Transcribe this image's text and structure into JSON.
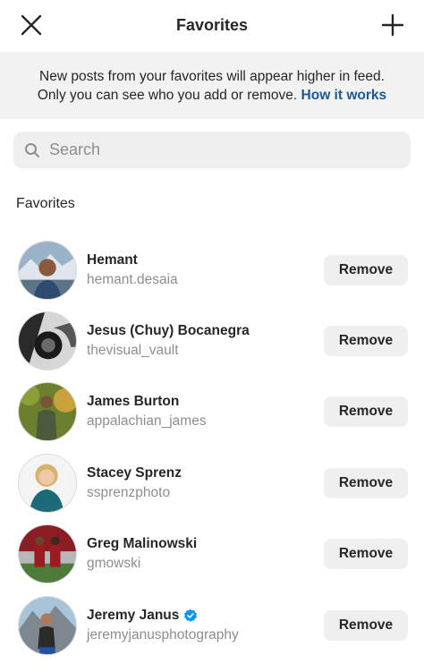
{
  "header": {
    "title": "Favorites",
    "close_icon": "close-icon",
    "add_icon": "plus-icon"
  },
  "banner": {
    "line1": "New posts from your favorites will appear higher in feed.",
    "line2": "Only you can see who you add or remove.",
    "link": "How it works",
    "link_color": "#1a5a96",
    "background": "#f2f2f2"
  },
  "search": {
    "placeholder": "Search",
    "icon": "search-icon"
  },
  "section": {
    "title": "Favorites"
  },
  "favorites": [
    {
      "name": "Hemant",
      "username": "hemant.desaia",
      "verified": false,
      "button": "Remove"
    },
    {
      "name": "Jesus (Chuy) Bocanegra",
      "username": "thevisual_vault",
      "verified": false,
      "button": "Remove"
    },
    {
      "name": "James Burton",
      "username": "appalachian_james",
      "verified": false,
      "button": "Remove"
    },
    {
      "name": "Stacey Sprenz",
      "username": "ssprenzphoto",
      "verified": false,
      "button": "Remove"
    },
    {
      "name": "Greg Malinowski",
      "username": "gmowski",
      "verified": false,
      "button": "Remove"
    },
    {
      "name": "Jeremy Janus",
      "username": "jeremyjanusphotography",
      "verified": true,
      "button": "Remove"
    }
  ],
  "colors": {
    "text": "#262626",
    "secondary_text": "#8e8e8e",
    "button_bg": "#efefef",
    "verified_badge": "#0095f6"
  }
}
